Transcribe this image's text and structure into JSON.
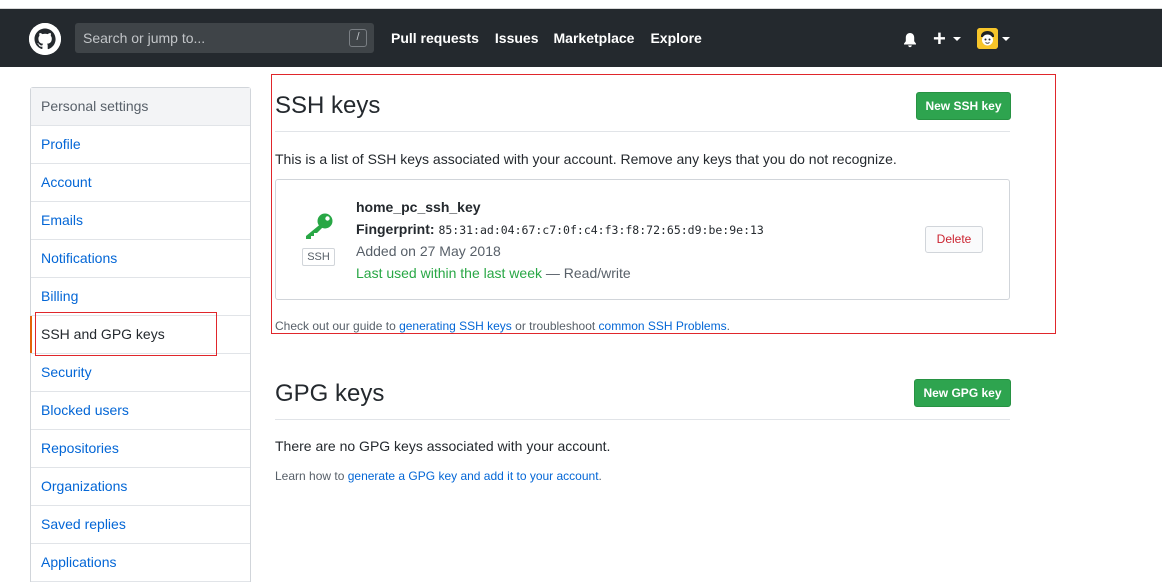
{
  "header": {
    "search_placeholder": "Search or jump to...",
    "search_shortcut": "/",
    "nav": [
      "Pull requests",
      "Issues",
      "Marketplace",
      "Explore"
    ],
    "plus": "+"
  },
  "sidebar": {
    "heading": "Personal settings",
    "items": [
      {
        "label": "Profile"
      },
      {
        "label": "Account"
      },
      {
        "label": "Emails"
      },
      {
        "label": "Notifications"
      },
      {
        "label": "Billing"
      },
      {
        "label": "SSH and GPG keys",
        "selected": true
      },
      {
        "label": "Security"
      },
      {
        "label": "Blocked users"
      },
      {
        "label": "Repositories"
      },
      {
        "label": "Organizations"
      },
      {
        "label": "Saved replies"
      },
      {
        "label": "Applications"
      }
    ]
  },
  "ssh": {
    "title": "SSH keys",
    "new_button": "New SSH key",
    "description": "This is a list of SSH keys associated with your account. Remove any keys that you do not recognize.",
    "key": {
      "name": "home_pc_ssh_key",
      "fingerprint_label": "Fingerprint:",
      "fingerprint": "85:31:ad:04:67:c7:0f:c4:f3:f8:72:65:d9:be:9e:13",
      "added": "Added on 27 May 2018",
      "last_used": "Last used within the last week",
      "access": " — Read/write",
      "badge": "SSH",
      "delete_button": "Delete"
    },
    "guide_prefix": "Check out our guide to ",
    "guide_link1": "generating SSH keys",
    "guide_middle": " or troubleshoot ",
    "guide_link2": "common SSH Problems",
    "guide_suffix": "."
  },
  "gpg": {
    "title": "GPG keys",
    "new_button": "New GPG key",
    "empty": "There are no GPG keys associated with your account.",
    "learn_prefix": "Learn how to ",
    "learn_link": "generate a GPG key and add it to your account",
    "learn_suffix": "."
  },
  "colors": {
    "header_bg": "#24292e",
    "green_button": "#2ea44f",
    "link": "#0366d6",
    "annotation_red": "#e0262b"
  }
}
